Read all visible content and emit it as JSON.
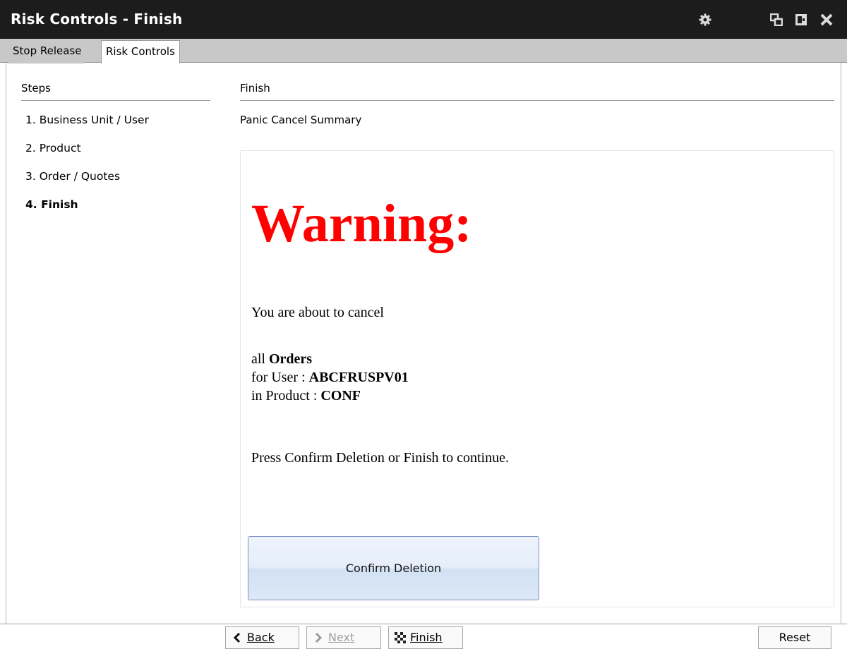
{
  "window": {
    "title": "Risk Controls - Finish",
    "icons": [
      "gear-icon",
      "restore-window-icon",
      "dock-window-icon",
      "close-icon"
    ]
  },
  "tabs": [
    {
      "label": "Stop Release",
      "active": false
    },
    {
      "label": "Risk Controls",
      "active": true
    }
  ],
  "steps": {
    "header": "Steps",
    "items": [
      {
        "label": "1.  Business Unit / User",
        "current": false
      },
      {
        "label": "2.  Product",
        "current": false
      },
      {
        "label": "3.  Order / Quotes",
        "current": false
      },
      {
        "label": "4.  Finish",
        "current": true
      }
    ]
  },
  "main": {
    "header": "Finish",
    "summary_label": "Panic Cancel Summary",
    "warning": "Warning:",
    "line_cancel": "You are about to cancel",
    "line_all_prefix": "all ",
    "line_all_value": "Orders",
    "line_user_prefix": "for User : ",
    "line_user_value": "ABCFRUSPV01",
    "line_product_prefix": "in Product : ",
    "line_product_value": "CONF",
    "line_press": "Press Confirm Deletion or Finish to continue.",
    "confirm_label": "Confirm Deletion"
  },
  "footer": {
    "back_label": "Back",
    "next_label": "Next",
    "finish_label": "Finish",
    "reset_label": "Reset",
    "next_enabled": false
  },
  "colors": {
    "titlebar": "#1c1c1c",
    "warning": "#ff0000",
    "confirm_border": "#7a95bf"
  }
}
